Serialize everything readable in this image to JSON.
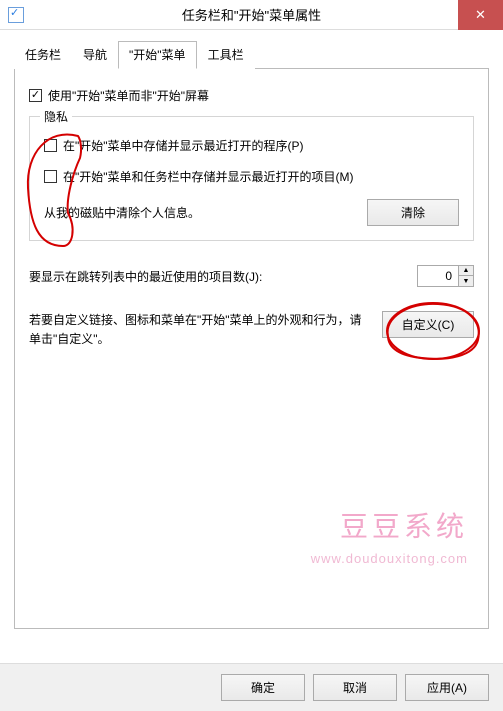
{
  "window": {
    "title": "任务栏和\"开始\"菜单属性"
  },
  "tabs": {
    "t0": "任务栏",
    "t1": "导航",
    "t2": "\"开始\"菜单",
    "t3": "工具栏"
  },
  "main": {
    "use_start_menu_label": "使用\"开始\"菜单而非\"开始\"屏幕",
    "privacy_legend": "隐私",
    "privacy_opt1": "在\"开始\"菜单中存储并显示最近打开的程序(P)",
    "privacy_opt2": "在\"开始\"菜单和任务栏中存储并显示最近打开的项目(M)",
    "clear_text": "从我的磁贴中清除个人信息。",
    "clear_btn": "清除",
    "jumplist_label": "要显示在跳转列表中的最近使用的项目数(J):",
    "jumplist_value": "0",
    "customize_text": "若要自定义链接、图标和菜单在\"开始\"菜单上的外观和行为，请单击\"自定义\"。",
    "customize_btn": "自定义(C)"
  },
  "footer": {
    "ok": "确定",
    "cancel": "取消",
    "apply": "应用(A)"
  },
  "watermark": {
    "name": "豆豆系统",
    "url": "www.doudouxitong.com"
  }
}
